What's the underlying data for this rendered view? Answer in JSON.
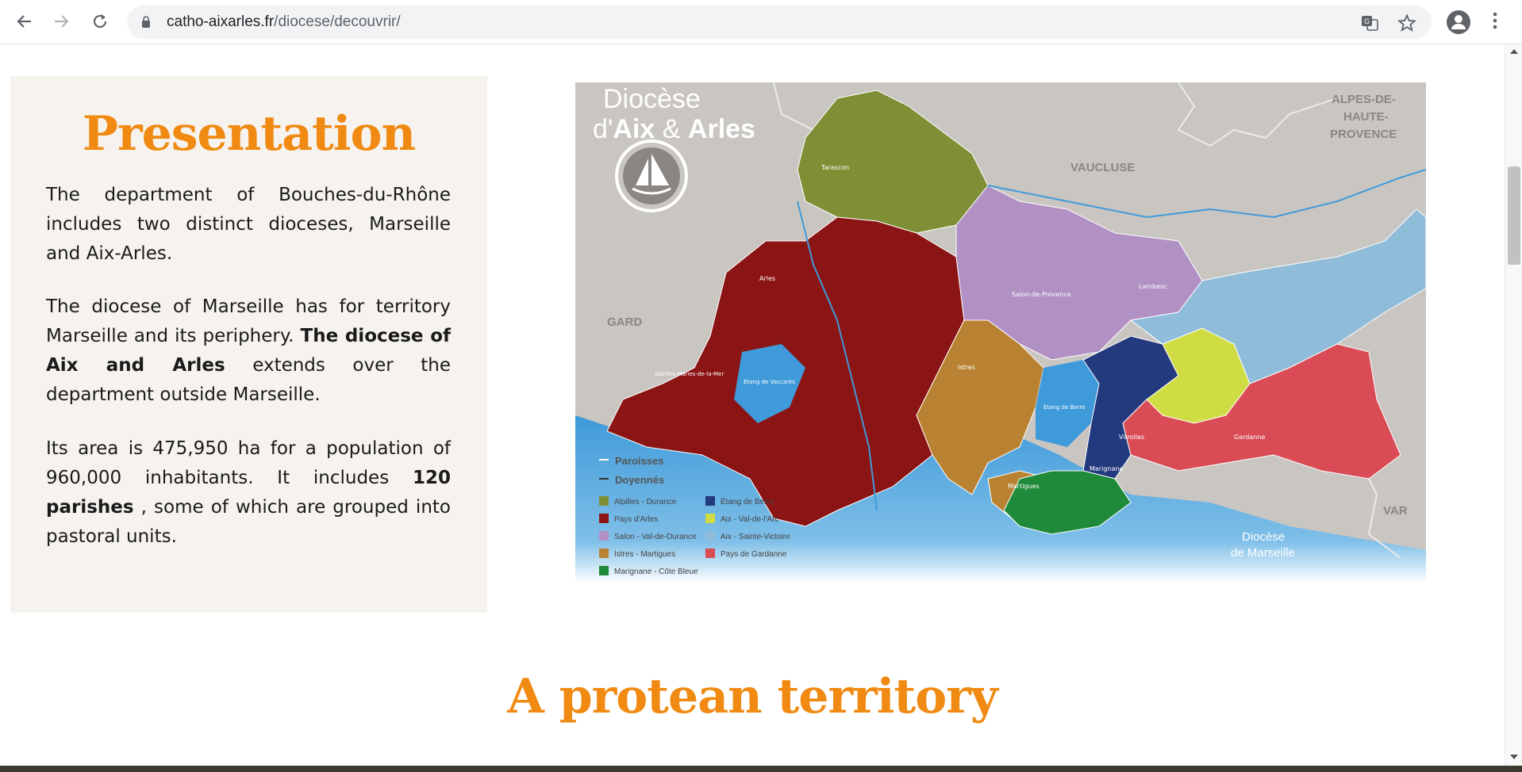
{
  "browser": {
    "url_domain": "catho-aixarles.fr",
    "url_path": "/diocese/decouvrir/"
  },
  "presentation": {
    "title": "Presentation",
    "p1": "The department of Bouches-du-Rhône includes two distinct dioceses, Marseille and Aix-Arles.",
    "p2_start": "The diocese of Marseille has for territory Marseille and its periphery. ",
    "p2_bold": "The diocese of Aix and Arles",
    "p2_end": " extends over the department outside Marseille.",
    "p3_start": "Its area is 475,950 ha for a population of 960,000 inhabitants. It includes ",
    "p3_bold": "120 parishes",
    "p3_end": " , some of which are grouped into pastoral units."
  },
  "map": {
    "title_line1": "Diocèse",
    "title_line2a": "d'",
    "title_line2b": "Aix",
    "title_line2c": " & ",
    "title_line2d": "Arles",
    "neighbors": {
      "vaucluse": "VAUCLUSE",
      "alpes_1": "ALPES-DE-",
      "alpes_2": "HAUTE-",
      "alpes_3": "PROVENCE",
      "gard": "GARD",
      "var": "VAR",
      "marseille_1": "Diocèse",
      "marseille_2": "de Marseille"
    },
    "legend_lines": {
      "paroisses": "Paroisses",
      "doyennes": "Doyennés"
    },
    "doyennes": [
      {
        "label": "Alpilles - Durance",
        "color": "#7f8f35"
      },
      {
        "label": "Pays d'Arles",
        "color": "#8b1414"
      },
      {
        "label": "Salon - Val-de-Durance",
        "color": "#b190c4"
      },
      {
        "label": "Istres - Martigues",
        "color": "#b98232"
      },
      {
        "label": "Marignane - Côte Bleue",
        "color": "#1f8a3a"
      },
      {
        "label": "Étang de Berre",
        "color": "#243a7e"
      },
      {
        "label": "Aix - Val-de-l'Arc",
        "color": "#cfdc43"
      },
      {
        "label": "Aix - Sainte-Victoire",
        "color": "#8fbcd9"
      },
      {
        "label": "Pays de Gardanne",
        "color": "#d94b55"
      }
    ],
    "places": {
      "arles": "Arles",
      "salon": "Salon-de-Provence",
      "istres": "Istres",
      "martigues": "Martigues",
      "tarascon": "Tarascon",
      "lambesc": "Lambesc",
      "gardanne": "Gardanne",
      "vitrolles": "Vitrolles",
      "marignane": "Marignane",
      "saintes_maries": "Saintes-Maries-de-la-Mer",
      "etang_vaccares": "Étang de Vaccarès",
      "etang_berre": "Étang de Berre"
    }
  },
  "section": {
    "title": "A protean territory"
  }
}
